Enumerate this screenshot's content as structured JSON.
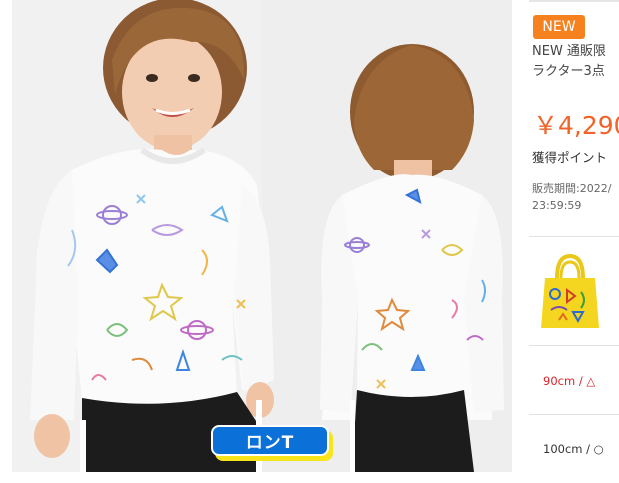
{
  "product": {
    "badge_label": "ロンT",
    "new_tag": "NEW",
    "title_line1": "NEW 通販限",
    "title_line2": "ラクター3点",
    "price": "￥4,290",
    "points_label": "獲得ポイント",
    "sale_period_line1": "販売期間:2022/",
    "sale_period_line2": "23:59:59"
  },
  "sizes": [
    {
      "label": "90cm / △",
      "color": "#d8232a"
    },
    {
      "label": "100cm / ○",
      "color": "#333333"
    }
  ],
  "colors": {
    "accent_orange": "#f5821f",
    "price_orange": "#f0642a",
    "badge_blue": "#0b71d9",
    "badge_yellow": "#f7e41a"
  }
}
